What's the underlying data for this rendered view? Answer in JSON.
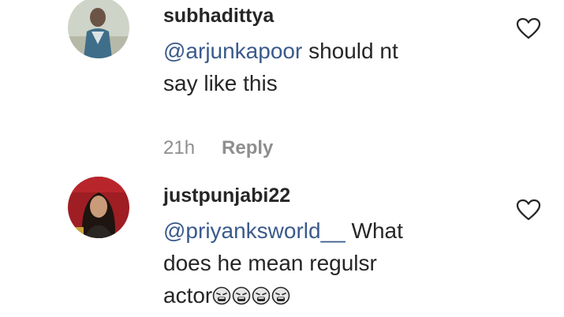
{
  "comments": [
    {
      "username": "subhadittya",
      "mention": "@arjunkapoor",
      "text_line1_rest": " should nt",
      "text_line2": "say like this",
      "time": "21h",
      "reply_label": "Reply"
    },
    {
      "username": "justpunjabi22",
      "mention": "@priyanksworld__",
      "text_line1_rest": " What",
      "text_line2": "does he mean regulsr",
      "text_line3": "actor",
      "emoji_count": 4,
      "emoji_name": "weary-face-emoji"
    }
  ],
  "icons": {
    "like": "heart-outline-icon"
  },
  "colors": {
    "mention": "#3a5a8c",
    "meta": "#8e8e8e",
    "text": "#262626"
  }
}
